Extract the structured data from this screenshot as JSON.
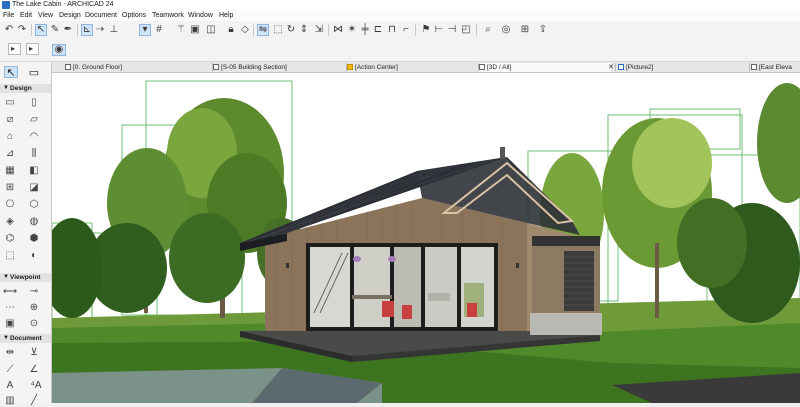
{
  "window": {
    "title": "The Lake Cabin - ARCHICAD 24"
  },
  "menu": {
    "items": [
      "File",
      "Edit",
      "View",
      "Design",
      "Document",
      "Options",
      "Teamwork",
      "Window",
      "Help"
    ]
  },
  "toolbar": {
    "row1_icons": [
      "undo-icon",
      "redo-icon",
      "arrow-select-icon",
      "eyedropper-icon",
      "syringe-icon",
      "snap-guides-icon",
      "guideline-icon",
      "grid-icon",
      "magic-wand-icon",
      "layers-icon",
      "suspend-groups-icon",
      "trace-icon",
      "mirror-icon",
      "drag-icon",
      "rotate-icon",
      "elevate-icon",
      "offset-icon",
      "flag-icon",
      "zoom-icon",
      "3d-orbit-icon",
      "stretch-icon",
      "explode-icon",
      "select-icon",
      "marquee-icon",
      "publish-icon"
    ],
    "row2_icons": [
      "info-box-icon",
      "cursor-arrow-icon",
      "select-arrow-icon",
      "orbit-icon"
    ]
  },
  "toolbox": {
    "sections": [
      {
        "label": "Design",
        "tools": [
          "wall-tool",
          "column-tool",
          "beam-tool",
          "slab-tool",
          "roof-tool",
          "shell-tool",
          "stair-tool",
          "railing-tool",
          "curtain-wall-tool",
          "door-tool",
          "window-tool",
          "skylight-tool",
          "object-tool",
          "zone-tool",
          "mesh-tool",
          "morph-tool",
          "lamp-tool",
          "cw-accessory-tool",
          "opening-tool",
          "lamp2-tool"
        ]
      },
      {
        "label": "Viewpoint",
        "tools": [
          "section-tool",
          "elevation-tool",
          "interior-elevation-tool",
          "worksheet-tool",
          "detail-tool",
          "camera-tool"
        ]
      },
      {
        "label": "Document",
        "tools": [
          "dimension-tool",
          "level-dim-tool",
          "text-tool",
          "label-tool",
          "fill-tool",
          "line-tool"
        ]
      }
    ]
  },
  "tabs": [
    {
      "label": "[0. Ground Floor]"
    },
    {
      "label": "[S-05 Building Section]"
    },
    {
      "label": "[Action Center]"
    },
    {
      "label": "[3D / All]"
    },
    {
      "label": "[Picture2]"
    },
    {
      "label": "[East Eleva"
    }
  ],
  "viewport": {
    "hint": "· · · ·"
  }
}
